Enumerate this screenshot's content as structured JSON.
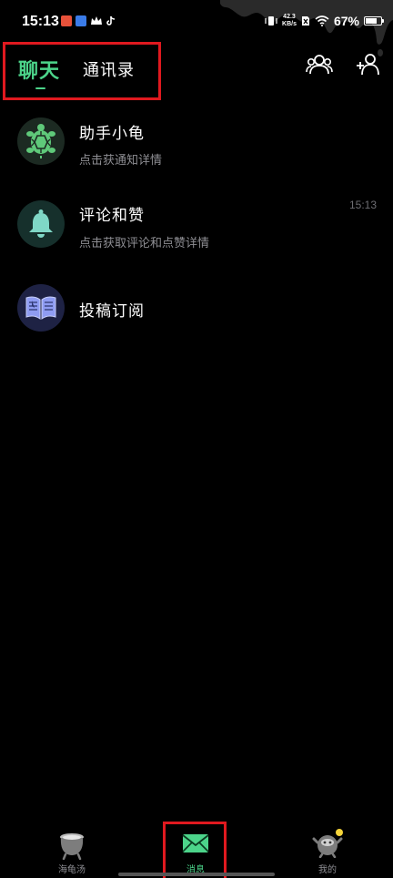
{
  "status_bar": {
    "time": "15:13",
    "net_speed_value": "42.3",
    "net_speed_unit": "KB/s",
    "battery_percent": "67%"
  },
  "header": {
    "tabs": [
      {
        "label": "聊天",
        "active": true
      },
      {
        "label": "通讯录",
        "active": false
      }
    ],
    "group_icon": "group-icon",
    "add_contact_icon": "add-contact-icon"
  },
  "conversations": [
    {
      "title": "助手小龟",
      "subtitle": "点击获通知详情",
      "time": "",
      "icon": "turtle-icon",
      "avatar_bg": "#1c2a22",
      "icon_color": "#5fc97a"
    },
    {
      "title": "评论和赞",
      "subtitle": "点击获取评论和点赞详情",
      "time": "15:13",
      "icon": "bell-icon",
      "avatar_bg": "#16302c",
      "icon_color": "#7fd7c6"
    },
    {
      "title": "投稿订阅",
      "subtitle": "",
      "time": "",
      "icon": "book-icon",
      "avatar_bg": "#1e2244",
      "icon_color": "#8f9cf2"
    }
  ],
  "bottom_nav": {
    "items": [
      {
        "label": "海龟汤",
        "icon": "cauldron-icon",
        "active": false
      },
      {
        "label": "消息",
        "icon": "envelope-icon",
        "active": true
      },
      {
        "label": "我的",
        "icon": "profile-icon",
        "active": false
      }
    ],
    "active_color": "#4cd48a"
  },
  "colors": {
    "accent": "#4cd48a",
    "highlight_box": "#e0191f",
    "background": "#000000",
    "secondary_text": "#8e8e93"
  }
}
